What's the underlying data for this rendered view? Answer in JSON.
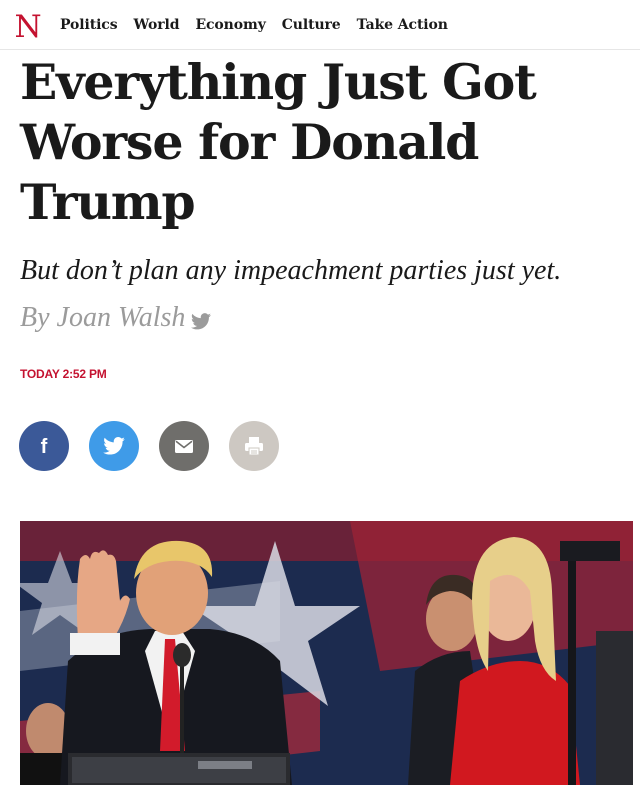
{
  "brand": {
    "logo_letter": "N",
    "logo_color": "#c41230"
  },
  "nav": {
    "items": [
      {
        "label": "Politics"
      },
      {
        "label": "World"
      },
      {
        "label": "Economy"
      },
      {
        "label": "Culture"
      },
      {
        "label": "Take Action"
      }
    ]
  },
  "article": {
    "headline": "Everything Just Got Worse for Donald Trump",
    "dek": "But don’t plan any impeachment parties just yet.",
    "byline_prefix": "By",
    "author": "Joan Walsh",
    "timestamp": "TODAY 2:52 PM"
  },
  "share": {
    "buttons": [
      {
        "icon": "facebook-icon",
        "color": "#3b5998"
      },
      {
        "icon": "twitter-icon",
        "color": "#3f9be8"
      },
      {
        "icon": "email-icon",
        "color": "#6f6e6b"
      },
      {
        "icon": "print-icon",
        "color": "#cdc8c2"
      }
    ]
  },
  "colors": {
    "accent": "#c41230",
    "byline": "#9b9b9b"
  }
}
